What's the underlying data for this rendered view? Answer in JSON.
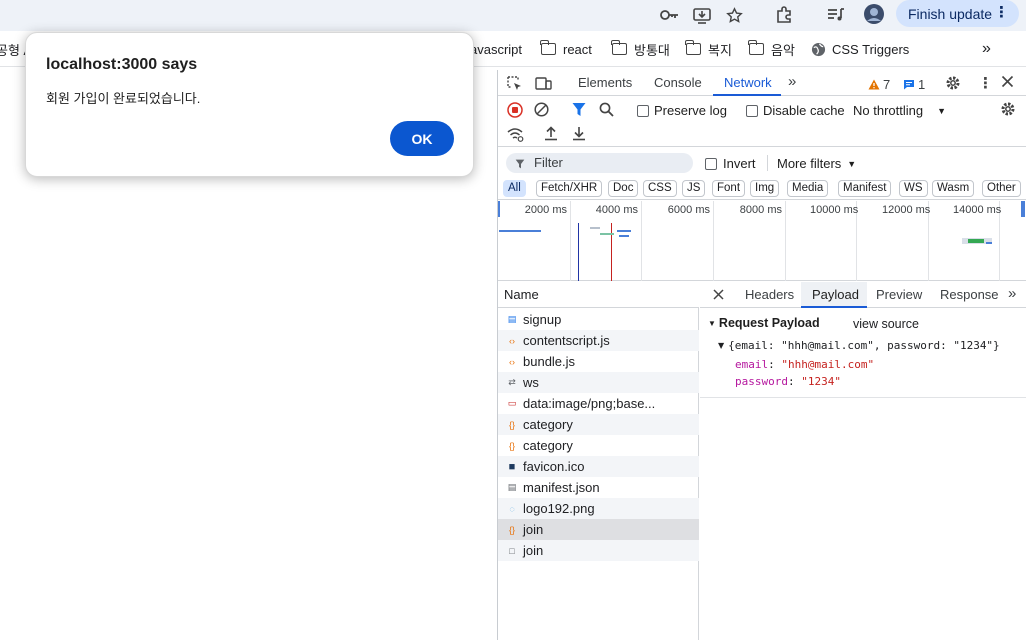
{
  "browser": {
    "finish_update_label": "Finish update",
    "menu_dots": "⋮",
    "toolbar_icons": [
      "key-icon",
      "install-icon",
      "star-icon",
      "extensions-icon",
      "media-control-icon",
      "profile-avatar"
    ]
  },
  "bookmarks": {
    "items": [
      {
        "label": "공형 A",
        "type": "folder-cut"
      },
      {
        "label": "avascript",
        "type": "cut"
      },
      {
        "label": "react",
        "type": "folder"
      },
      {
        "label": "방통대",
        "type": "folder"
      },
      {
        "label": "복지",
        "type": "folder"
      },
      {
        "label": "음악",
        "type": "folder"
      },
      {
        "label": "CSS Triggers",
        "type": "site"
      }
    ],
    "overflow": "»"
  },
  "alert": {
    "title": "localhost:3000 says",
    "message": "회원 가입이 완료되었습니다.",
    "ok_label": "OK"
  },
  "devtools": {
    "tabs": [
      "Elements",
      "Console",
      "Network"
    ],
    "active_tab": "Network",
    "warnings_count": "7",
    "messages_count": "1",
    "toolbar": {
      "preserve_log": "Preserve log",
      "disable_cache": "Disable cache",
      "throttling": "No throttling"
    },
    "filter": {
      "placeholder": "Filter",
      "invert": "Invert",
      "more_filters": "More filters"
    },
    "type_filters": [
      "All",
      "Fetch/XHR",
      "Doc",
      "CSS",
      "JS",
      "Font",
      "Img",
      "Media",
      "Manifest",
      "WS",
      "Wasm",
      "Other"
    ],
    "timeline_labels": [
      "2000 ms",
      "4000 ms",
      "6000 ms",
      "8000 ms",
      "10000 ms",
      "12000 ms",
      "14000 ms"
    ],
    "name_header": "Name",
    "requests": [
      {
        "name": "signup",
        "kind": "doc",
        "color": "#1a73e8"
      },
      {
        "name": "contentscript.js",
        "kind": "script",
        "color": "#e8710a"
      },
      {
        "name": "bundle.js",
        "kind": "script",
        "color": "#e8710a"
      },
      {
        "name": "ws",
        "kind": "ws",
        "color": "#5f6368"
      },
      {
        "name": "data:image/png;base...",
        "kind": "img",
        "color": "#c5221f"
      },
      {
        "name": "category",
        "kind": "fetch",
        "color": "#e8710a"
      },
      {
        "name": "category",
        "kind": "fetch",
        "color": "#e8710a"
      },
      {
        "name": "favicon.ico",
        "kind": "ico",
        "color": "#1e3a5f"
      },
      {
        "name": "manifest.json",
        "kind": "manifest",
        "color": "#5f6368"
      },
      {
        "name": "logo192.png",
        "kind": "png",
        "color": "#4aa3df"
      },
      {
        "name": "join",
        "kind": "fetch",
        "color": "#e8710a"
      },
      {
        "name": "join",
        "kind": "other",
        "color": "#5f6368"
      }
    ],
    "selected_request_index": 10,
    "detail_tabs": [
      "Headers",
      "Payload",
      "Preview",
      "Response"
    ],
    "active_detail_tab": "Payload",
    "payload": {
      "section_title": "Request Payload",
      "view_source": "view source",
      "summary": "{email: \"hhh@mail.com\", password: \"1234\"}",
      "fields": [
        {
          "key": "email",
          "value": "\"hhh@mail.com\""
        },
        {
          "key": "password",
          "value": "\"1234\""
        }
      ]
    },
    "colors": {
      "accent": "#1a5bd6",
      "key_color": "#b5179e",
      "string_color": "#c5221f",
      "warning": "#e37400"
    }
  }
}
